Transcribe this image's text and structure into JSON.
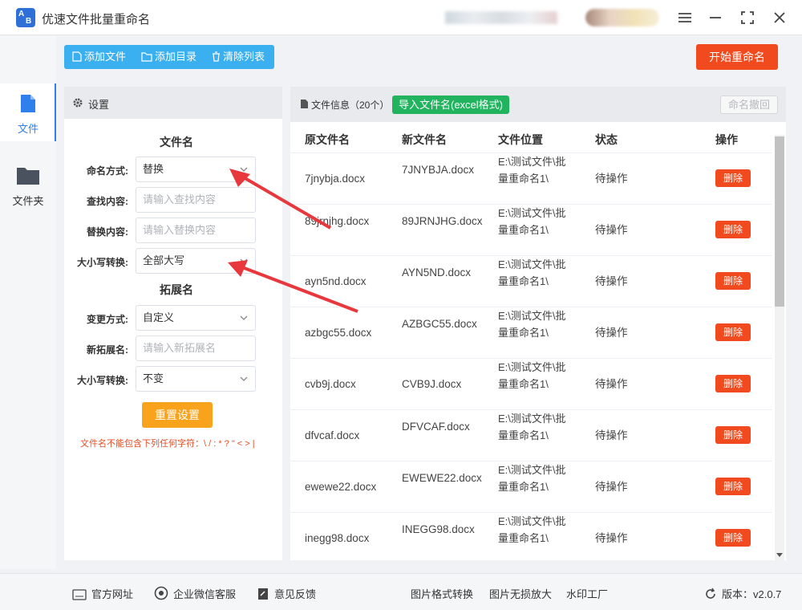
{
  "app": {
    "title": "优速文件批量重命名",
    "logo_text_a": "A",
    "logo_text_b": "B"
  },
  "nav": [
    {
      "label": "文件",
      "icon": "file-icon",
      "active": true
    },
    {
      "label": "文件夹",
      "icon": "folder-icon",
      "active": false
    }
  ],
  "toolbar": {
    "add_file": "添加文件",
    "add_dir": "添加目录",
    "clear_list": "清除列表"
  },
  "start_button": "开始重命名",
  "settings": {
    "header": "设置",
    "filename_section": "文件名",
    "naming_mode_label": "命名方式:",
    "naming_mode_value": "替换",
    "find_label": "查找内容:",
    "find_placeholder": "请输入查找内容",
    "replace_label": "替换内容:",
    "replace_placeholder": "请输入替换内容",
    "case_label": "大小写转换:",
    "case_value": "全部大写",
    "ext_section": "拓展名",
    "change_mode_label": "变更方式:",
    "change_mode_value": "自定义",
    "new_ext_label": "新拓展名:",
    "new_ext_placeholder": "请输入新拓展名",
    "ext_case_label": "大小写转换:",
    "ext_case_value": "不变",
    "reset_button": "重置设置",
    "warning": "文件名不能包含下列任何字符：\\ / : * ? \" < > |"
  },
  "file_panel": {
    "title": "文件信息（20个）",
    "import_button": "导入文件名(excel格式)",
    "undo_button": "命名撤回",
    "columns": [
      "原文件名",
      "新文件名",
      "文件位置",
      "状态",
      "操作"
    ],
    "delete_label": "删除",
    "rows": [
      {
        "orig": "7jnybja.docx",
        "new": "7JNYBJA.docx",
        "loc": "E:\\测试文件\\批量重命名1\\",
        "status": "待操作"
      },
      {
        "orig": "89jrnjhg.docx",
        "new": "89JRNJHG.docx",
        "loc": "E:\\测试文件\\批量重命名1\\",
        "status": "待操作"
      },
      {
        "orig": "ayn5nd.docx",
        "new": "AYN5ND.docx",
        "loc": "E:\\测试文件\\批量重命名1\\",
        "status": "待操作"
      },
      {
        "orig": "azbgc55.docx",
        "new": "AZBGC55.docx",
        "loc": "E:\\测试文件\\批量重命名1\\",
        "status": "待操作"
      },
      {
        "orig": "cvb9j.docx",
        "new": "CVB9J.docx",
        "loc": "E:\\测试文件\\批量重命名1\\",
        "status": "待操作"
      },
      {
        "orig": "dfvcaf.docx",
        "new": "DFVCAF.docx",
        "loc": "E:\\测试文件\\批量重命名1\\",
        "status": "待操作"
      },
      {
        "orig": "ewewe22.docx",
        "new": "EWEWE22.docx",
        "loc": "E:\\测试文件\\批量重命名1\\",
        "status": "待操作"
      },
      {
        "orig": "inegg98.docx",
        "new": "INEGG98.docx",
        "loc": "E:\\测试文件\\批量重命名1\\",
        "status": "待操作"
      }
    ]
  },
  "footer": {
    "website": "官方网址",
    "wechat": "企业微信客服",
    "feedback": "意见反馈",
    "img_convert": "图片格式转换",
    "img_enlarge": "图片无损放大",
    "watermark": "水印工厂",
    "version": "版本：v2.0.7"
  },
  "colors": {
    "accent": "#3ab0f0",
    "primary_red": "#f04a1e",
    "orange": "#f8a31b",
    "green": "#22b35e"
  }
}
